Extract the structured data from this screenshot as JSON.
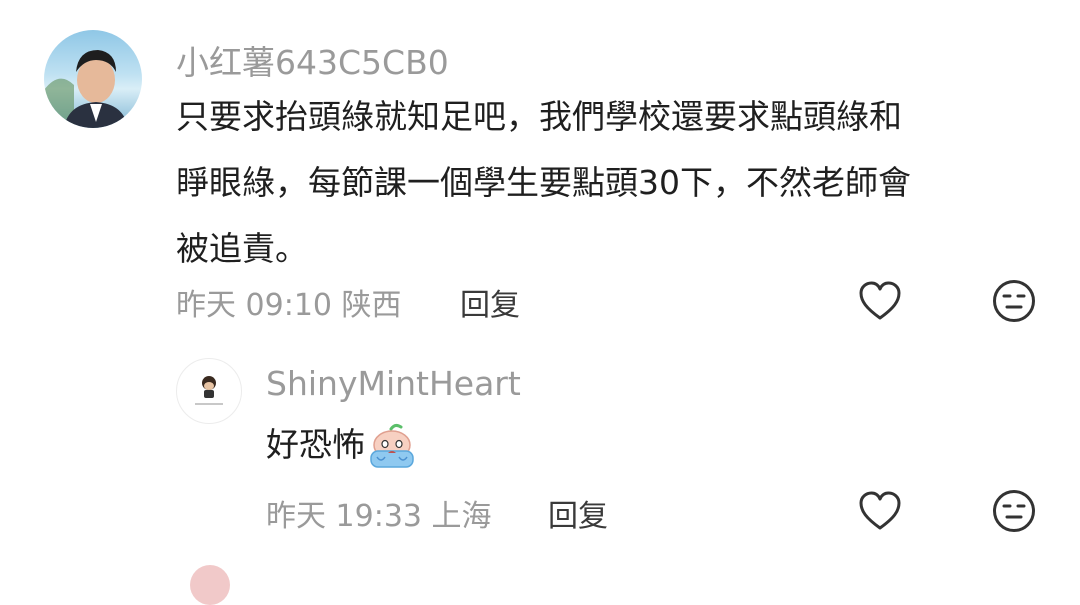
{
  "comments": [
    {
      "username": "小红薯643C5CB0",
      "text_lines": [
        "只要求抬頭綠就知足吧，我們學校還要求點頭綠和",
        "睜眼綠，每節課一個學生要點頭30下，不然老師會",
        "被追責。"
      ],
      "meta": "昨天 09:10 陕西",
      "reply_label": "回复",
      "like_icon": "heart-outline-icon",
      "dislike_icon": "neutral-face-icon"
    },
    {
      "username": "ShinyMintHeart",
      "text": "好恐怖",
      "emoji_icon": "crying-emoji-icon",
      "meta": "昨天 19:33 上海",
      "reply_label": "回复",
      "like_icon": "heart-outline-icon",
      "dislike_icon": "neutral-face-icon"
    }
  ],
  "colors": {
    "text": "#1f1f1f",
    "muted": "#9a9a9a",
    "icon": "#333333"
  }
}
